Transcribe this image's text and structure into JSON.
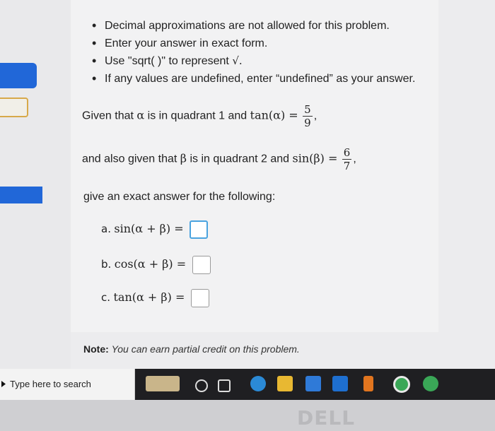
{
  "instructions": [
    "Decimal approximations are not allowed for this problem.",
    "Enter your answer in exact form.",
    "Use \"sqrt( )\" to represent",
    "If any values are undefined, enter “undefined” as your answer."
  ],
  "sqrt_symbol": "√.",
  "given1": {
    "lead": "Given that",
    "var": "α",
    "middle": "is in quadrant 1 and",
    "func": "tan(α) =",
    "num": "5",
    "den": "9",
    "tail": ","
  },
  "given2": {
    "lead": "and also given that",
    "var": "β",
    "middle": "is in quadrant 2 and",
    "func": "sin(β) =",
    "num": "6",
    "den": "7",
    "tail": ","
  },
  "prompt": "give an exact answer for the following:",
  "parts": [
    {
      "label": "a.",
      "expr": "sin(α + β) ="
    },
    {
      "label": "b.",
      "expr": "cos(α + β) ="
    },
    {
      "label": "c.",
      "expr": "tan(α + β) ="
    }
  ],
  "note": {
    "label": "Note:",
    "text": "You can earn partial credit on this problem."
  },
  "taskbar": {
    "search_placeholder": "Type here to search"
  },
  "brand": "DELL"
}
